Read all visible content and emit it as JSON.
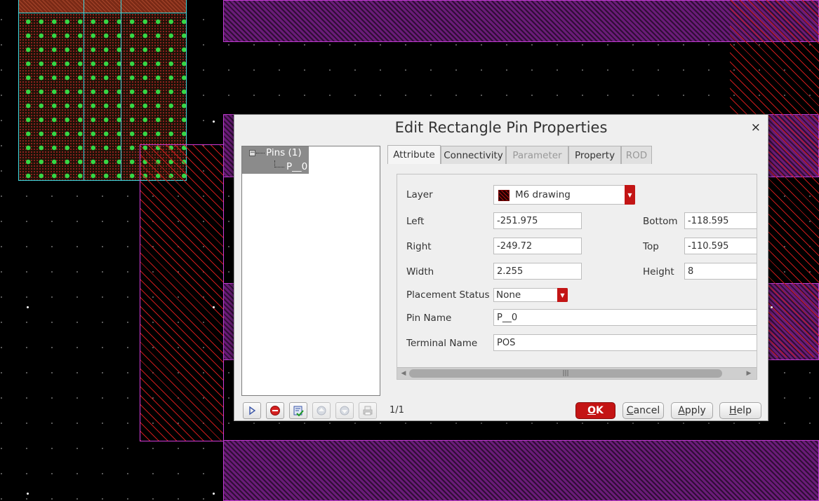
{
  "window": {
    "title": "Edit Rectangle Pin Properties",
    "close_glyph": "×"
  },
  "tree": {
    "root_label": "Pins (1)",
    "child_label": "P__0",
    "expander_glyph": "−"
  },
  "toolbar": {
    "count": "1/1",
    "icons": [
      "play-icon",
      "stop-icon",
      "checklist-icon",
      "arrow-up-icon",
      "arrow-down-icon",
      "print-icon"
    ]
  },
  "tabs": [
    {
      "label": "Attribute",
      "state": "active"
    },
    {
      "label": "Connectivity",
      "state": "normal"
    },
    {
      "label": "Parameter",
      "state": "disabled"
    },
    {
      "label": "Property",
      "state": "normal"
    },
    {
      "label": "ROD",
      "state": "disabled"
    }
  ],
  "form": {
    "layer": {
      "label": "Layer",
      "value": "M6 drawing"
    },
    "left": {
      "label": "Left",
      "value": "-251.975"
    },
    "right": {
      "label": "Right",
      "value": "-249.72"
    },
    "width": {
      "label": "Width",
      "value": "2.255"
    },
    "bottom": {
      "label": "Bottom",
      "value": "-118.595"
    },
    "top": {
      "label": "Top",
      "value": "-110.595"
    },
    "height": {
      "label": "Height",
      "value": "8"
    },
    "placement_status": {
      "label": "Placement Status",
      "value": "None"
    },
    "pin_name": {
      "label": "Pin Name",
      "value": "P__0"
    },
    "terminal_name": {
      "label": "Terminal Name",
      "value": "POS"
    }
  },
  "buttons": {
    "ok": {
      "first": "O",
      "rest": "K"
    },
    "cancel": {
      "first": "C",
      "rest": "ancel"
    },
    "apply": {
      "first": "A",
      "rest": "pply"
    },
    "help": {
      "first": "H",
      "rest": "elp"
    }
  },
  "colors": {
    "accent_red": "#c41414",
    "metal_purple": "#6a1c78",
    "via_green": "#35d845",
    "outline_cyan": "#3fd8e0",
    "canvas_black": "#000000"
  }
}
